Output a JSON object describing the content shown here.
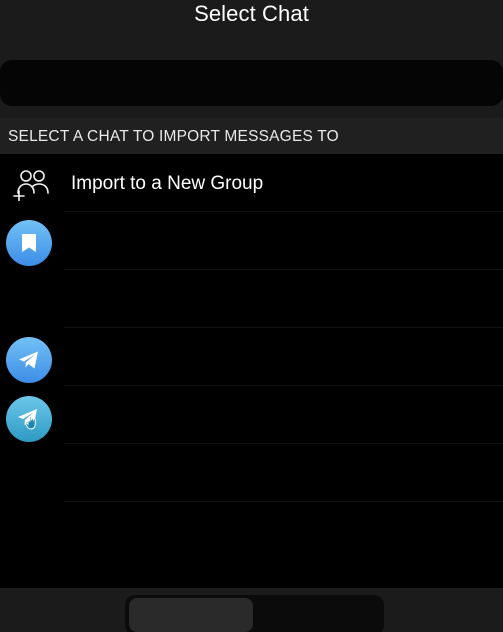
{
  "header": {
    "title": "Select Chat"
  },
  "search": {
    "placeholder": "",
    "value": ""
  },
  "section": {
    "title": "SELECT A CHAT TO IMPORT MESSAGES TO"
  },
  "list": {
    "items": [
      {
        "label": "Import to a New Group",
        "icon": "add-group-icon"
      },
      {
        "label": "",
        "icon": "saved-messages-icon"
      },
      {
        "label": "",
        "icon": ""
      },
      {
        "label": "",
        "icon": "telegram-plane-icon"
      },
      {
        "label": "",
        "icon": "telegram-plane-touch-icon"
      },
      {
        "label": "",
        "icon": ""
      },
      {
        "label": "",
        "icon": ""
      }
    ]
  },
  "bottom": {
    "segments": [
      {
        "label": "",
        "state": "active"
      },
      {
        "label": "",
        "state": "inactive"
      }
    ]
  },
  "colors": {
    "background": "#000000",
    "header": "#1b1b1b",
    "section_header": "#202020",
    "avatar_gradient_start": "#72c1f5",
    "avatar_gradient_end": "#3d8de8"
  }
}
